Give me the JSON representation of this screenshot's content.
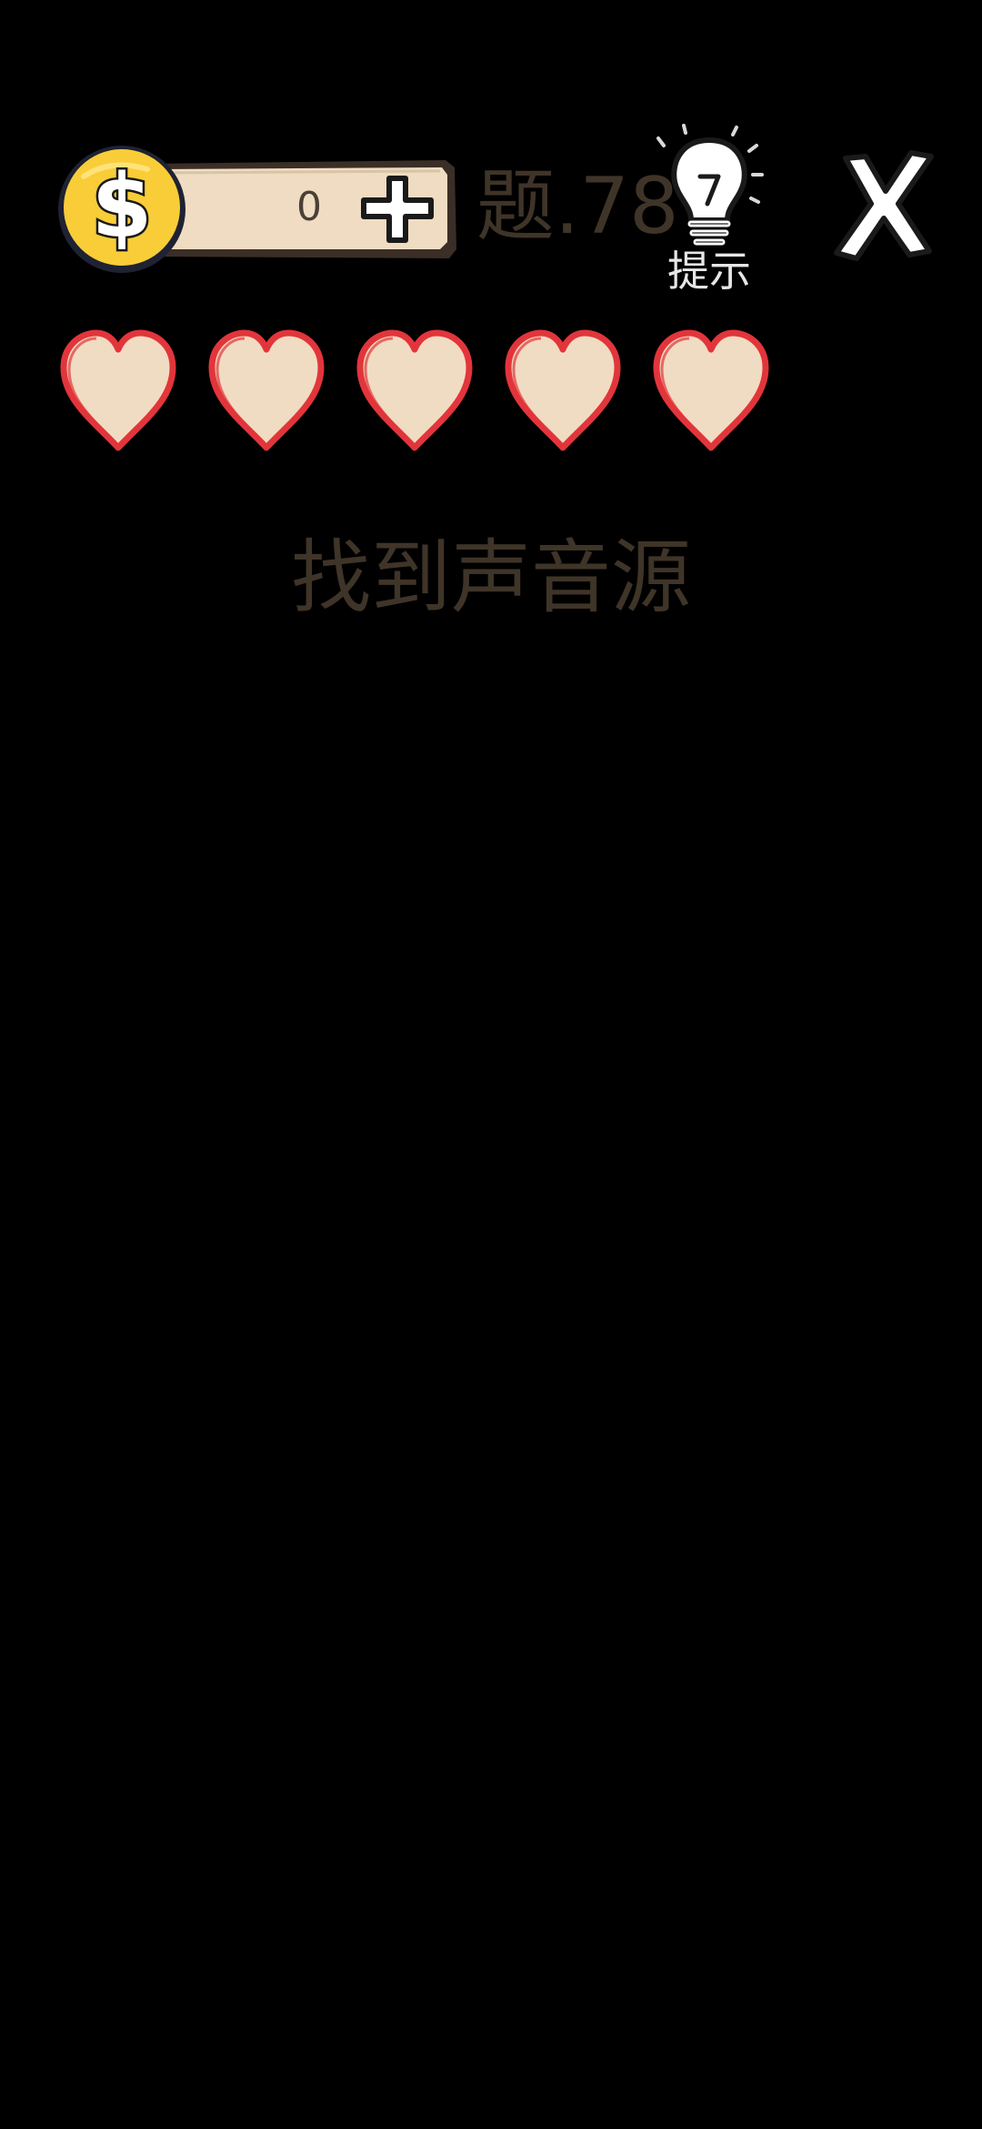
{
  "hud": {
    "coins": "0",
    "level_label": "题.78",
    "hint_label": "提示",
    "lives": 5
  },
  "question": {
    "text": "找到声音源"
  },
  "colors": {
    "background": "#000000",
    "coin_yellow": "#f9cd37",
    "panel_beige": "#efdcc2",
    "heart_fill": "#f0dcc2",
    "heart_stroke": "#e2353b",
    "dim_text": "#3f3428"
  },
  "icons": {
    "coin": "dollar-coin-icon",
    "add": "plus-icon",
    "hint": "lightbulb-icon",
    "close": "close-x-icon",
    "life": "heart-icon"
  }
}
